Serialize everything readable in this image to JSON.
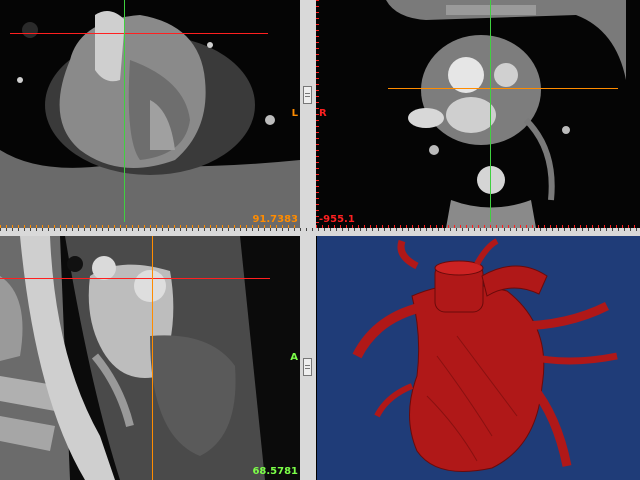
{
  "viewer": {
    "panes": {
      "a": {
        "readout": "91.7383",
        "readout_color": "#ff8c00",
        "orient_right": "L"
      },
      "b": {
        "readout": "-955.1",
        "readout_color": "#ff2020",
        "orient_left": "R"
      },
      "c": {
        "readout": "68.5781",
        "readout_color": "#7cff48",
        "orient_right": "A"
      },
      "d": {
        "background": "#1f3c78",
        "model_color": "#b01818",
        "icon": "heart-3d-render"
      }
    },
    "crosshair_colors": {
      "horizontal": "#ff2020",
      "vertical": "#40d040",
      "orange": "#ff8c00"
    }
  }
}
